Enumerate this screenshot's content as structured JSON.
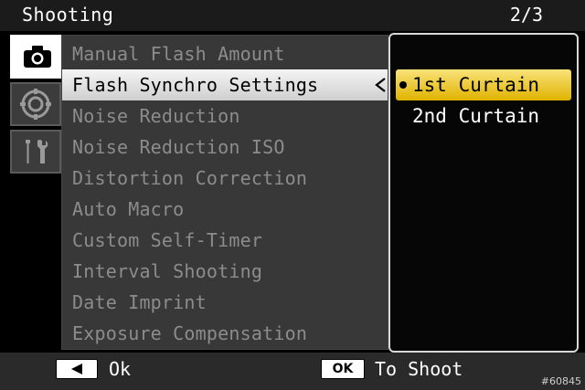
{
  "header": {
    "title": "Shooting",
    "page_indicator": "2/3"
  },
  "tabs": [
    {
      "icon": "camera-icon",
      "active": true
    },
    {
      "icon": "dial-icon",
      "active": false
    },
    {
      "icon": "wrench-screwdriver-icon",
      "active": false
    }
  ],
  "menu": {
    "items": [
      {
        "label": "Manual Flash Amount"
      },
      {
        "label": "Flash Synchro Settings",
        "selected": true
      },
      {
        "label": "Noise Reduction"
      },
      {
        "label": "Noise Reduction ISO"
      },
      {
        "label": "Distortion Correction"
      },
      {
        "label": "Auto Macro"
      },
      {
        "label": "Custom Self-Timer"
      },
      {
        "label": "Interval Shooting"
      },
      {
        "label": "Date Imprint"
      },
      {
        "label": "Exposure Compensation"
      }
    ]
  },
  "submenu": {
    "options": [
      {
        "label": "1st Curtain",
        "selected": true
      },
      {
        "label": "2nd Curtain",
        "selected": false
      }
    ]
  },
  "footer": {
    "back_label": "Ok",
    "ok_button": "OK",
    "ok_label": "To Shoot"
  },
  "watermark": "#60845",
  "colors": {
    "selection_highlight": "#f0c020",
    "menu_highlight": "#e6e6e6",
    "menu_text_dim": "#8c8c8c"
  }
}
